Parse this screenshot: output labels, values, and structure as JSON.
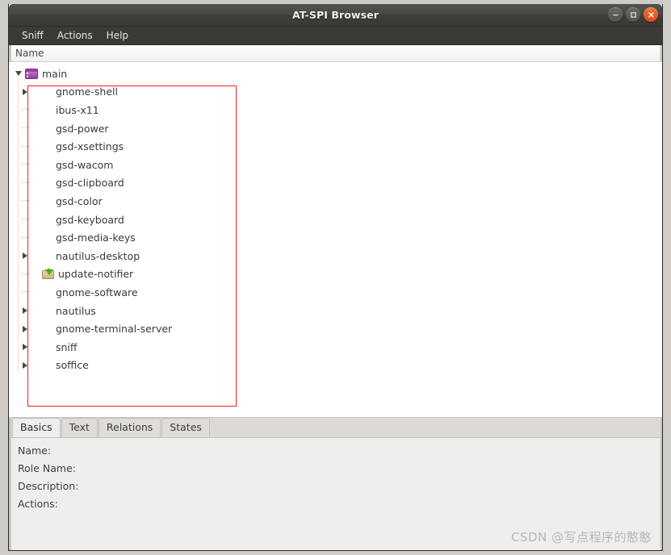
{
  "window": {
    "title": "AT-SPI Browser",
    "controls": [
      {
        "name": "minimize",
        "glyph": "–"
      },
      {
        "name": "maximize",
        "glyph": "□"
      },
      {
        "name": "close",
        "glyph": "×"
      }
    ]
  },
  "menubar": {
    "items": [
      {
        "label": "Sniff"
      },
      {
        "label": "Actions"
      },
      {
        "label": "Help"
      }
    ]
  },
  "tree": {
    "column_header": "Name",
    "rows": [
      {
        "label": "main",
        "depth": 0,
        "expander": "down",
        "icon": "window-icon"
      },
      {
        "label": "gnome-shell",
        "depth": 1,
        "expander": "right",
        "icon": "none"
      },
      {
        "label": "ibus-x11",
        "depth": 1,
        "expander": "none",
        "icon": "none"
      },
      {
        "label": "gsd-power",
        "depth": 1,
        "expander": "none",
        "icon": "none"
      },
      {
        "label": "gsd-xsettings",
        "depth": 1,
        "expander": "none",
        "icon": "none"
      },
      {
        "label": "gsd-wacom",
        "depth": 1,
        "expander": "none",
        "icon": "none"
      },
      {
        "label": "gsd-clipboard",
        "depth": 1,
        "expander": "none",
        "icon": "none"
      },
      {
        "label": "gsd-color",
        "depth": 1,
        "expander": "none",
        "icon": "none"
      },
      {
        "label": "gsd-keyboard",
        "depth": 1,
        "expander": "none",
        "icon": "none"
      },
      {
        "label": "gsd-media-keys",
        "depth": 1,
        "expander": "none",
        "icon": "none"
      },
      {
        "label": "nautilus-desktop",
        "depth": 1,
        "expander": "right",
        "icon": "none"
      },
      {
        "label": "update-notifier",
        "depth": 1,
        "expander": "none",
        "icon": "package-download-icon"
      },
      {
        "label": "gnome-software",
        "depth": 1,
        "expander": "none",
        "icon": "none"
      },
      {
        "label": "nautilus",
        "depth": 1,
        "expander": "right",
        "icon": "none"
      },
      {
        "label": "gnome-terminal-server",
        "depth": 1,
        "expander": "right",
        "icon": "none"
      },
      {
        "label": "sniff",
        "depth": 1,
        "expander": "right",
        "icon": "none"
      },
      {
        "label": "soffice",
        "depth": 1,
        "expander": "right",
        "icon": "none"
      }
    ]
  },
  "notebook": {
    "tabs": [
      {
        "label": "Basics",
        "active": true
      },
      {
        "label": "Text",
        "active": false
      },
      {
        "label": "Relations",
        "active": false
      },
      {
        "label": "States",
        "active": false
      }
    ],
    "basics_fields": [
      {
        "label": "Name:",
        "value": ""
      },
      {
        "label": "Role Name:",
        "value": ""
      },
      {
        "label": "Description:",
        "value": ""
      },
      {
        "label": "Actions:",
        "value": ""
      }
    ]
  },
  "annotation": {
    "highlight_color": "#f41f1f"
  },
  "watermark": {
    "text": "CSDN @写点程序的憨憨"
  }
}
